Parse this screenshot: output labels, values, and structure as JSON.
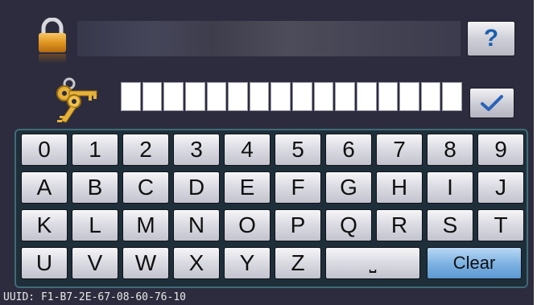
{
  "header": {
    "help_label": "?",
    "help_icon": "question-mark-icon"
  },
  "code_entry": {
    "box_count": 16,
    "confirm_icon": "checkmark-icon"
  },
  "keyboard": {
    "rows": [
      [
        "0",
        "1",
        "2",
        "3",
        "4",
        "5",
        "6",
        "7",
        "8",
        "9"
      ],
      [
        "A",
        "B",
        "C",
        "D",
        "E",
        "F",
        "G",
        "H",
        "I",
        "J"
      ],
      [
        "K",
        "L",
        "M",
        "N",
        "O",
        "P",
        "Q",
        "R",
        "S",
        "T"
      ],
      [
        "U",
        "V",
        "W",
        "X",
        "Y",
        "Z"
      ]
    ],
    "space_label": "⎵",
    "clear_label": "Clear"
  },
  "footer": {
    "uuid_text": "UUID: F1-B7-2E-67-08-60-76-10"
  },
  "colors": {
    "background": "#2c2c3e",
    "keyboard_bg": "#1e2f3a",
    "clear_key": "#7fb3e3",
    "help_text": "#1b5fae"
  }
}
